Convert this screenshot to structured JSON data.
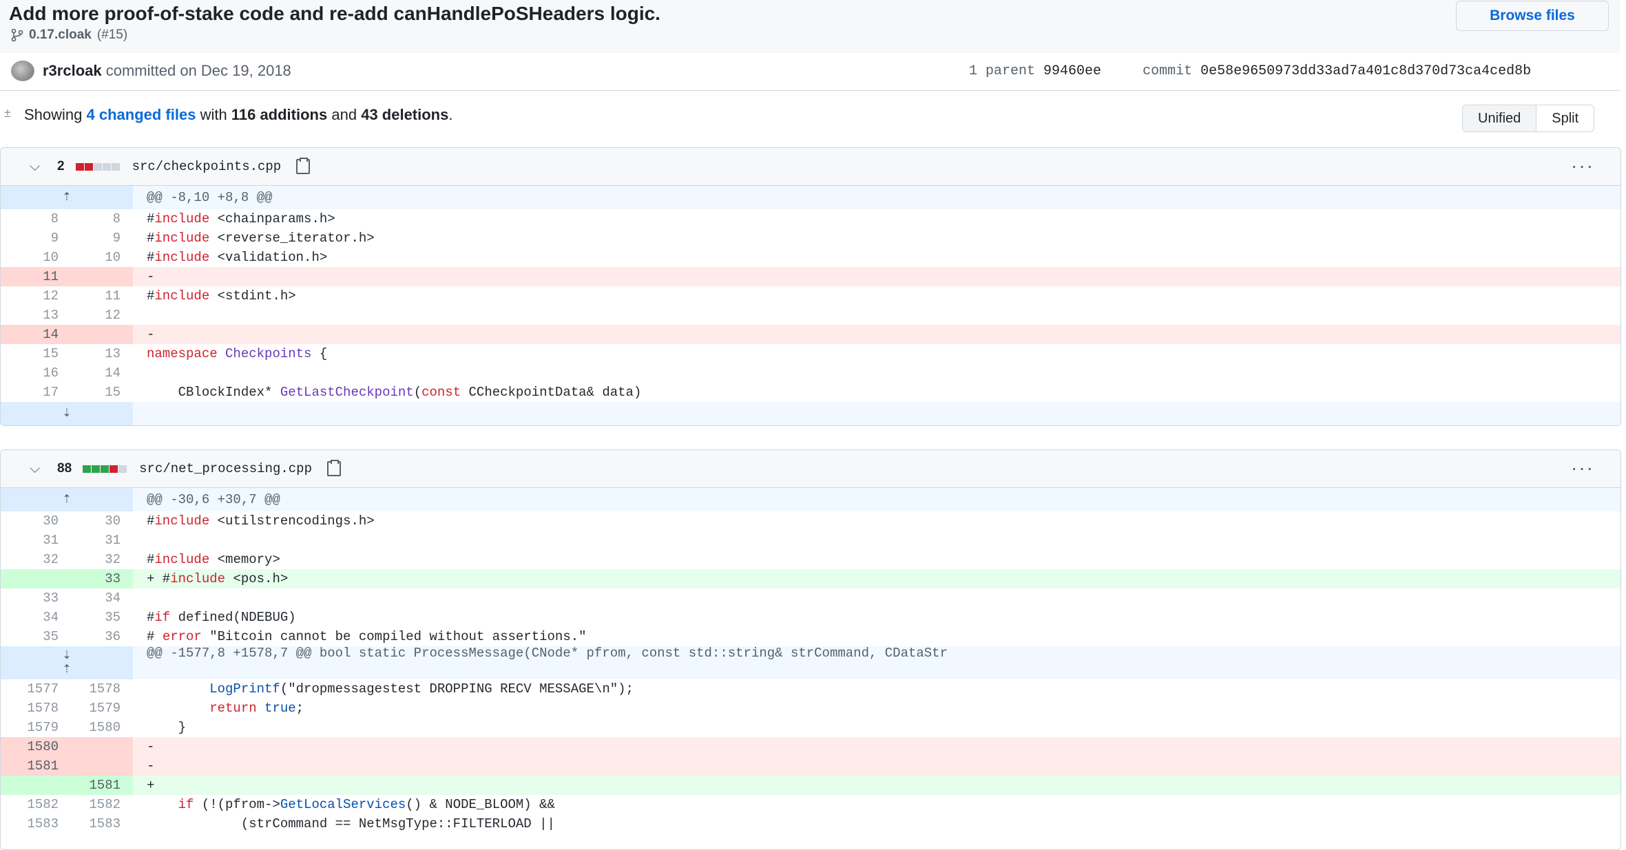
{
  "commit": {
    "title": "Add more proof-of-stake code and re-add canHandlePoSHeaders logic.",
    "branch": "0.17.cloak",
    "pr_ref": "(#15)",
    "browse_files": "Browse files",
    "author": "r3rcloak",
    "committed_text": "committed on Dec 19, 2018",
    "parent_label": "1 parent",
    "parent_hash": "99460ee",
    "commit_label": "commit",
    "commit_hash": "0e58e9650973dd33ad7a401c8d370d73ca4ced8b"
  },
  "summary": {
    "prefix": "Showing",
    "changed_files": "4 changed files",
    "with": "with",
    "additions": "116 additions",
    "and": "and",
    "deletions": "43 deletions",
    "suffix": "."
  },
  "view_toggle": {
    "unified": "Unified",
    "split": "Split"
  },
  "files": [
    {
      "count": "2",
      "name": "src/checkpoints.cpp",
      "blocks": [
        "del",
        "del",
        "neu",
        "neu",
        "neu"
      ],
      "lines": [
        {
          "t": "hunk",
          "code": "@@ -8,10 +8,8 @@"
        },
        {
          "t": "ctx",
          "o": "8",
          "n": "8",
          "code": "#include <chainparams.h>"
        },
        {
          "t": "ctx",
          "o": "9",
          "n": "9",
          "code": "#include <reverse_iterator.h>"
        },
        {
          "t": "ctx",
          "o": "10",
          "n": "10",
          "code": "#include <validation.h>"
        },
        {
          "t": "del",
          "o": "11",
          "n": "",
          "code": "-"
        },
        {
          "t": "ctx",
          "o": "12",
          "n": "11",
          "code": "#include <stdint.h>"
        },
        {
          "t": "ctx",
          "o": "13",
          "n": "12",
          "code": ""
        },
        {
          "t": "del",
          "o": "14",
          "n": "",
          "code": "-"
        },
        {
          "t": "ctx",
          "o": "15",
          "n": "13",
          "code": "namespace Checkpoints {"
        },
        {
          "t": "ctx",
          "o": "16",
          "n": "14",
          "code": ""
        },
        {
          "t": "ctx",
          "o": "17",
          "n": "15",
          "code": "    CBlockIndex* GetLastCheckpoint(const CCheckpointData& data)"
        },
        {
          "t": "expand",
          "code": ""
        }
      ]
    },
    {
      "count": "88",
      "name": "src/net_processing.cpp",
      "blocks": [
        "add",
        "add",
        "add",
        "del",
        "neu"
      ],
      "lines": [
        {
          "t": "hunk",
          "code": "@@ -30,6 +30,7 @@"
        },
        {
          "t": "ctx",
          "o": "30",
          "n": "30",
          "code": "#include <utilstrencodings.h>"
        },
        {
          "t": "ctx",
          "o": "31",
          "n": "31",
          "code": ""
        },
        {
          "t": "ctx",
          "o": "32",
          "n": "32",
          "code": "#include <memory>"
        },
        {
          "t": "add",
          "o": "",
          "n": "33",
          "code": "+ #include <pos.h>"
        },
        {
          "t": "ctx",
          "o": "33",
          "n": "34",
          "code": ""
        },
        {
          "t": "ctx",
          "o": "34",
          "n": "35",
          "code": "#if defined(NDEBUG)"
        },
        {
          "t": "ctx",
          "o": "35",
          "n": "36",
          "code": "# error \"Bitcoin cannot be compiled without assertions.\""
        },
        {
          "t": "hunk2",
          "code": "@@ -1577,8 +1578,7 @@ bool static ProcessMessage(CNode* pfrom, const std::string& strCommand, CDataStr"
        },
        {
          "t": "ctx",
          "o": "1577",
          "n": "1578",
          "code": "        LogPrintf(\"dropmessagestest DROPPING RECV MESSAGE\\n\");"
        },
        {
          "t": "ctx",
          "o": "1578",
          "n": "1579",
          "code": "        return true;"
        },
        {
          "t": "ctx",
          "o": "1579",
          "n": "1580",
          "code": "    }"
        },
        {
          "t": "del",
          "o": "1580",
          "n": "",
          "code": "-"
        },
        {
          "t": "del",
          "o": "1581",
          "n": "",
          "code": "-"
        },
        {
          "t": "add",
          "o": "",
          "n": "1581",
          "code": "+"
        },
        {
          "t": "ctx",
          "o": "1582",
          "n": "1582",
          "code": "    if (!(pfrom->GetLocalServices() & NODE_BLOOM) &&"
        },
        {
          "t": "ctx",
          "o": "1583",
          "n": "1583",
          "code": "            (strCommand == NetMsgType::FILTERLOAD ||"
        }
      ]
    }
  ]
}
